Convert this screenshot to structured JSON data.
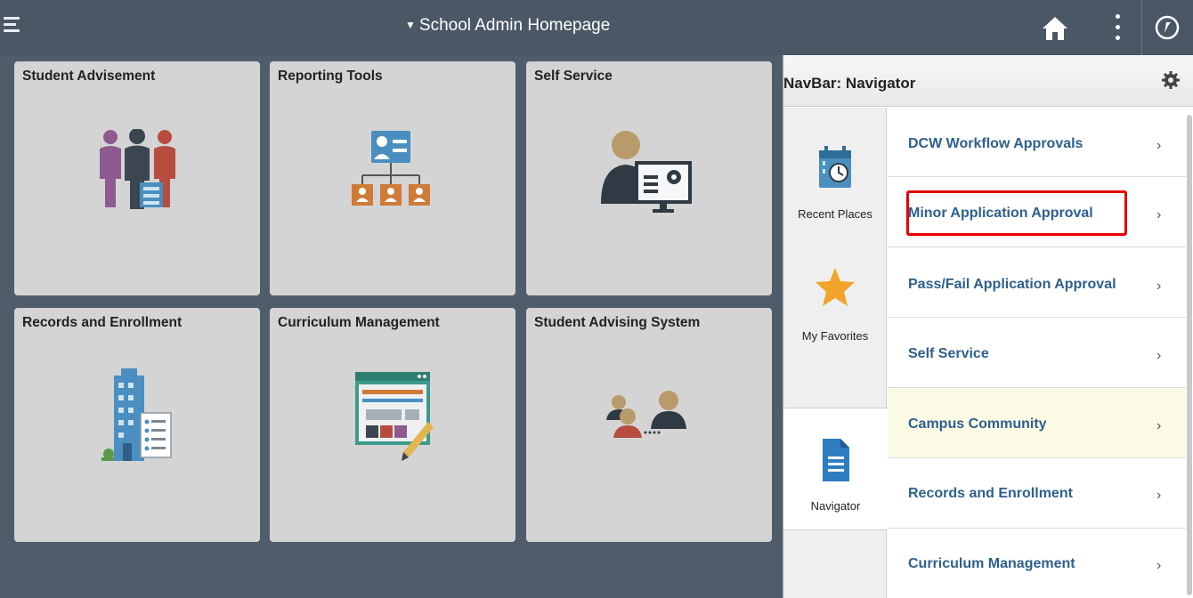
{
  "header": {
    "title": "School Admin Homepage",
    "caret": "▼",
    "icons": [
      "menu-icon",
      "home-icon",
      "actions-list-icon",
      "navbar-icon"
    ]
  },
  "tiles": [
    {
      "title": "Student Advisement",
      "icon": "people-group-icon"
    },
    {
      "title": "Reporting Tools",
      "icon": "org-chart-icon"
    },
    {
      "title": "Self Service",
      "icon": "person-monitor-icon"
    },
    {
      "title": "Records and Enrollment",
      "icon": "building-document-icon"
    },
    {
      "title": "Curriculum Management",
      "icon": "webpage-pencil-icon"
    },
    {
      "title": "Student Advising System",
      "icon": "two-people-connect-icon"
    }
  ],
  "navbar": {
    "title": "NavBar: Navigator",
    "side": [
      {
        "label": "Recent Places",
        "icon": "calendar-clock-icon"
      },
      {
        "label": "My Favorites",
        "icon": "star-icon"
      },
      {
        "label": "Navigator",
        "icon": "document-icon"
      }
    ],
    "items": [
      {
        "label": "DCW Workflow Approvals",
        "chevron": "›"
      },
      {
        "label": "Minor Application Approval",
        "chevron": "›"
      },
      {
        "label": "Pass/Fail Application Approval",
        "chevron": "›"
      },
      {
        "label": "Self Service",
        "chevron": "›"
      },
      {
        "label": "Campus Community",
        "chevron": "›"
      },
      {
        "label": "Records and Enrollment",
        "chevron": "›"
      },
      {
        "label": "Curriculum Management",
        "chevron": "›"
      }
    ]
  },
  "colors": {
    "header_bg": "#4a5866",
    "page_bg": "#4f5d6b",
    "tile_bg": "#d4d4d4",
    "nav_link": "#2e5f8e",
    "highlight_row": "#fbfbe6",
    "annotation_box": "#e60000"
  }
}
